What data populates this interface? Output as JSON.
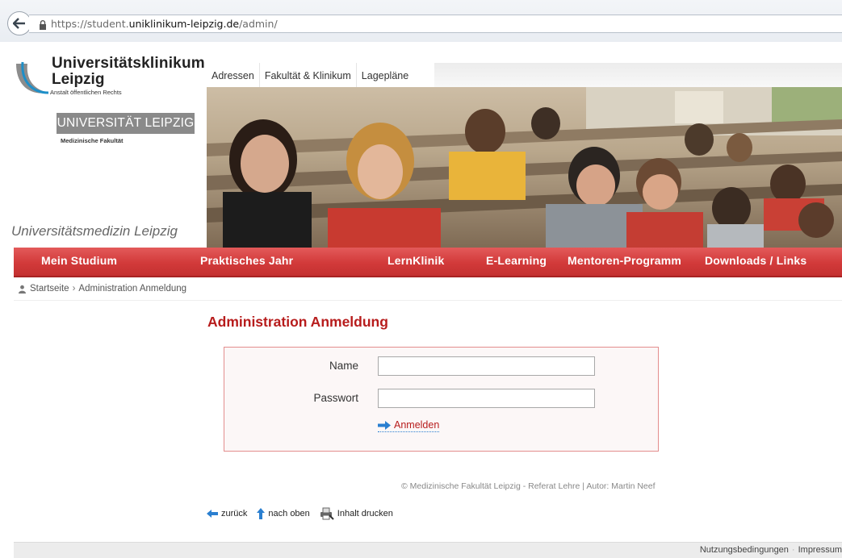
{
  "browser": {
    "url_scheme": "https://student.",
    "url_domain": "uniklinikum-leipzig.de",
    "url_path": "/admin/"
  },
  "logo": {
    "title": "Universitätsklinikum",
    "subtitle": "Leipzig",
    "legal": "Anstalt öffentlichen Rechts",
    "uni_name": "UNIVERSITÄT LEIPZIG",
    "faculty": "Medizinische Fakultät",
    "slogan": "Universitätsmedizin Leipzig"
  },
  "top_links": [
    "Adressen",
    "Fakultät & Klinikum",
    "Lagepläne"
  ],
  "nav": [
    "Mein Studium",
    "Praktisches Jahr",
    "LernKlinik",
    "E-Learning",
    "Mentoren-Programm",
    "Downloads / Links"
  ],
  "breadcrumb": {
    "home": "Startseite",
    "separator": "›",
    "current": "Administration Anmeldung"
  },
  "page": {
    "title": "Administration Anmeldung"
  },
  "login": {
    "name_label": "Name",
    "name_value": "",
    "password_label": "Passwort",
    "password_value": "",
    "submit_label": "Anmelden"
  },
  "footer": {
    "credit": "© Medizinische Fakultät Leipzig - Referat Lehre | Autor: Martin Neef",
    "back": "zurück",
    "top": "nach oben",
    "print": "Inhalt drucken",
    "terms": "Nutzungsbedingungen",
    "imprint": "Impressum"
  },
  "colors": {
    "accent_red": "#d23a3a",
    "title_red": "#b71c1c",
    "link_blue": "#2a7fd0"
  },
  "icons": [
    "back-arrow-icon",
    "lock-icon",
    "user-icon",
    "arrow-right-icon",
    "arrow-left-icon",
    "arrow-up-icon",
    "printer-icon"
  ]
}
